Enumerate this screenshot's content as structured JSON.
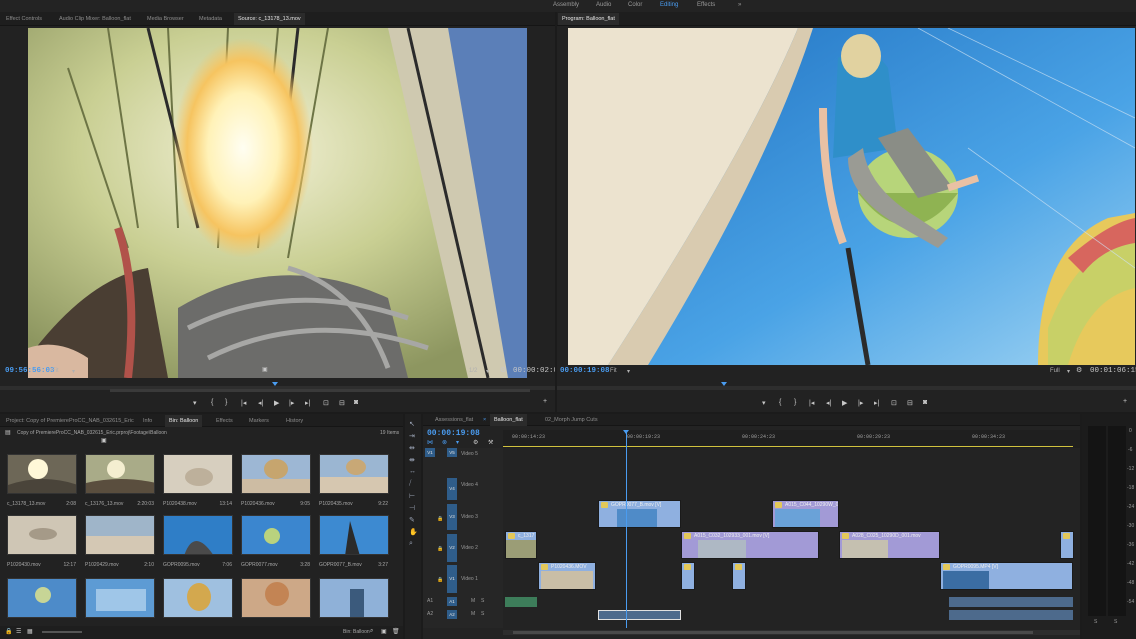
{
  "workspaces": [
    {
      "label": "Assembly",
      "active": false
    },
    {
      "label": "Audio",
      "active": false
    },
    {
      "label": "Color",
      "active": false
    },
    {
      "label": "Editing",
      "active": true
    },
    {
      "label": "Effects",
      "active": false
    }
  ],
  "more_workspaces": "»",
  "source_panel": {
    "tabs": [
      "Effect Controls",
      "Audio Clip Mixer: Balloon_flat",
      "Media Browser",
      "Metadata",
      "Source: c_13178_13.mov"
    ],
    "timecode": "09:56:56:03",
    "fit": "Fit",
    "resolution": "1/2",
    "duration": "00:00:02:08"
  },
  "program_panel": {
    "tab": "Program: Balloon_flat",
    "timecode": "00:00:19:08",
    "fit": "Fit",
    "resolution": "Full",
    "duration": "00:01:06:15"
  },
  "transport_icons": [
    "marker-icon",
    "in-icon",
    "out-icon",
    "go-in-icon",
    "step-back-icon",
    "play-icon",
    "step-forward-icon",
    "go-out-icon",
    "insert-icon",
    "overwrite-icon",
    "export-frame-icon"
  ],
  "project_panel": {
    "tabs": [
      "Project: Copy of PremiereProCC_NAB_032615_Eric",
      "Info",
      "Bin: Balloon",
      "Effects",
      "Markers",
      "History"
    ],
    "path": "Copy of PremiereProCC_NAB_032615_Eric.prproj\\Footage\\Balloon",
    "item_count": "19 Items",
    "items": [
      {
        "name": "c_13178_13.mov",
        "dur": "2:08"
      },
      {
        "name": "c_13176_13.mov",
        "dur": "2:20:03"
      },
      {
        "name": "P1020438.mov",
        "dur": "13:14"
      },
      {
        "name": "P1020436.mov",
        "dur": "9:05"
      },
      {
        "name": "P1020435.mov",
        "dur": "9:22"
      },
      {
        "name": "P1020430.mov",
        "dur": "12:17"
      },
      {
        "name": "P1020429.mov",
        "dur": "2:10"
      },
      {
        "name": "GOPR0095.mov",
        "dur": "7:06"
      },
      {
        "name": "GOPR0077.mov",
        "dur": "3:28"
      },
      {
        "name": "GOPR0077_B.mov",
        "dur": "3:27"
      },
      {
        "name": "",
        "dur": ""
      },
      {
        "name": "",
        "dur": ""
      },
      {
        "name": "",
        "dur": ""
      },
      {
        "name": "",
        "dur": ""
      },
      {
        "name": "",
        "dur": ""
      }
    ],
    "bin_label": "Bin: Balloon"
  },
  "timeline": {
    "tabs": [
      "Assessions_flat",
      "Balloon_flat",
      "02_Morph Jump Cuts"
    ],
    "close_mark": "×",
    "timecode": "00:00:19:08",
    "ruler": [
      "00:00:14:23",
      "00:00:19:23",
      "00:00:24:23",
      "00:00:29:23",
      "00:00:34:23"
    ],
    "tracks": {
      "v5": "Video 5",
      "v4": "Video 4",
      "v3": "Video 3",
      "v2": "Video 2",
      "v1": "Video 1",
      "V5": "V5",
      "V4": "V4",
      "V3": "V3",
      "V2": "V2",
      "V1": "V1",
      "A1": "A1",
      "A2": "A2",
      "M": "M",
      "S": "S"
    },
    "clips": {
      "gopr_b": "GOPR0077_B.mov [V]",
      "a015_044": "A015_C044_10290W_0",
      "c13178": "c_1317",
      "a015_032": "A015_C032_102933_001.mov [V]",
      "a028": "A028_C025_10290D_001.mov",
      "p1020436": "P1020436.MOV",
      "gopr0095": "GOPR0095.MP4 [V]"
    }
  },
  "meter_scale": [
    "0",
    "-6",
    "-12",
    "-18",
    "-24",
    "-30",
    "-36",
    "-42",
    "-48",
    "-54",
    "S",
    "S"
  ]
}
